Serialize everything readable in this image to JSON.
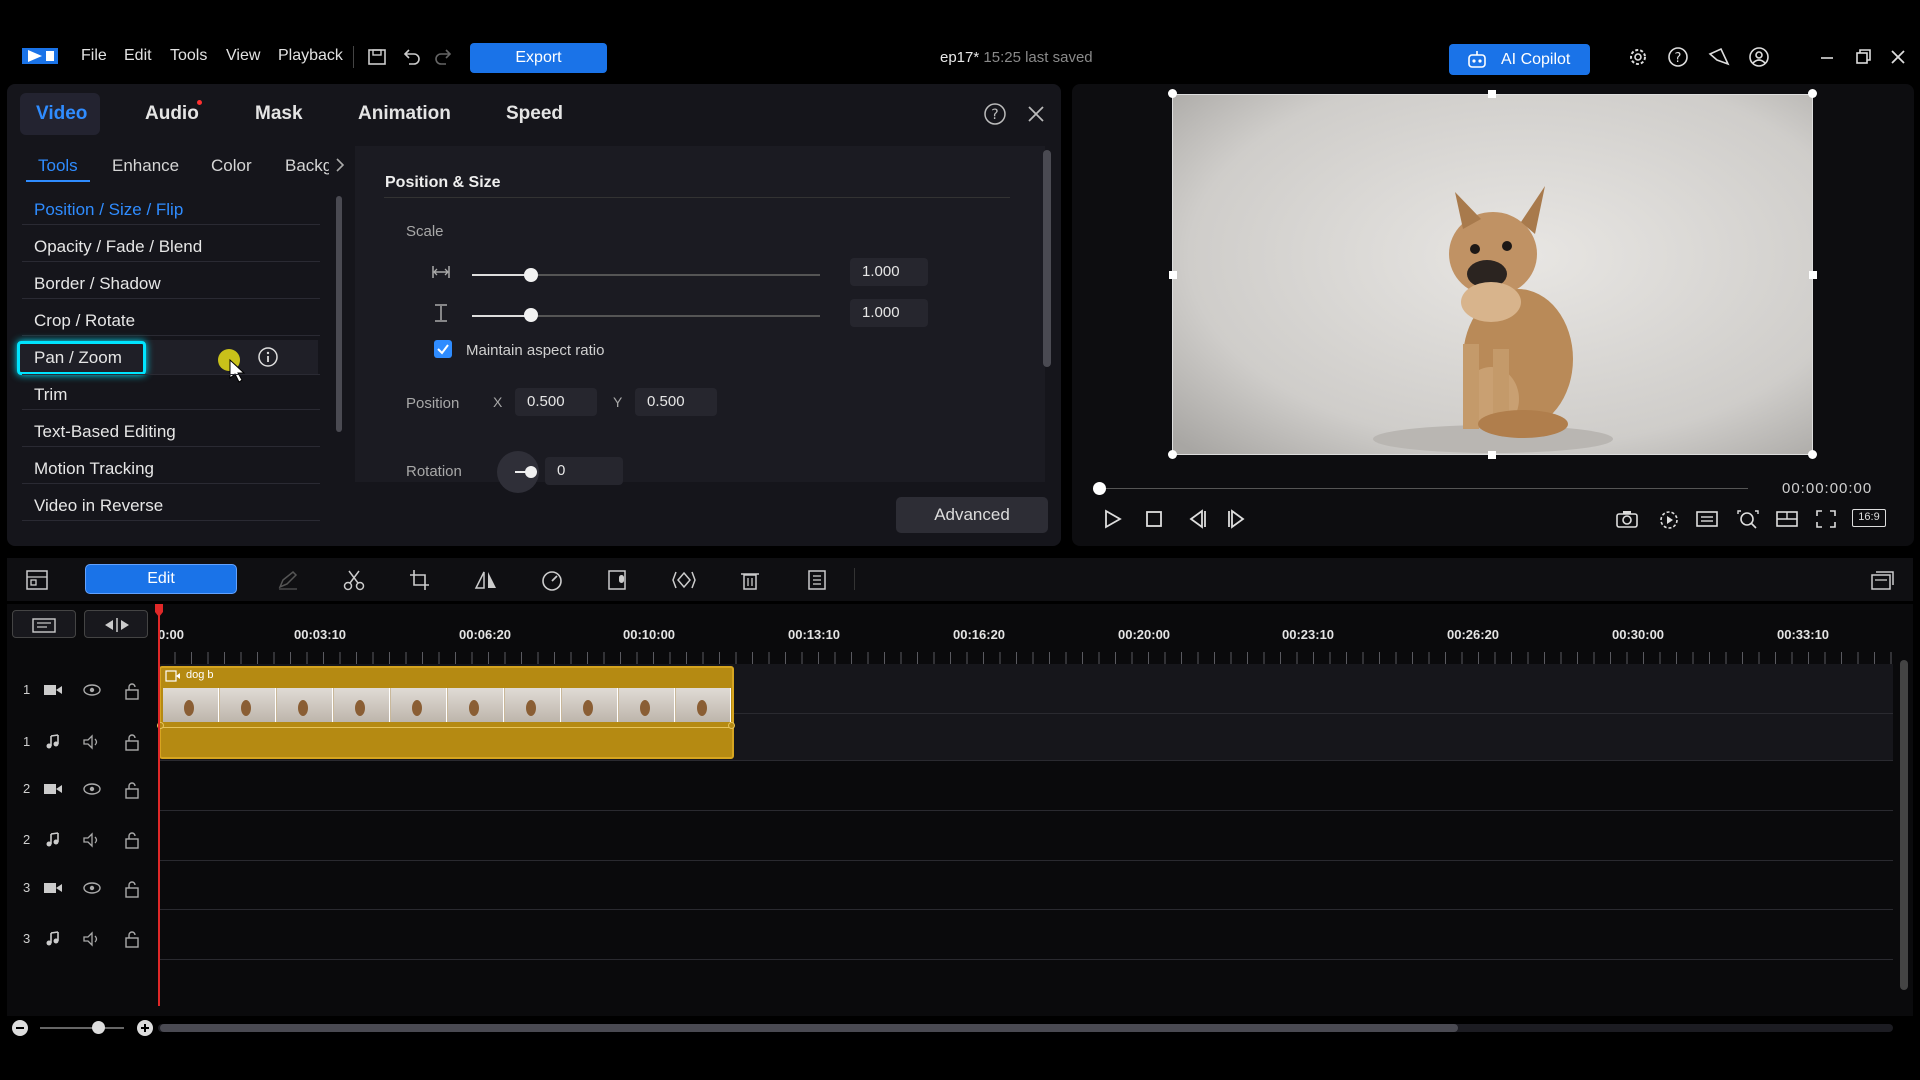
{
  "menu": {
    "file": "File",
    "edit": "Edit",
    "tools": "Tools",
    "view": "View",
    "playback": "Playback"
  },
  "export_label": "Export",
  "project": {
    "name": "ep17*",
    "saved": "15:25 last saved"
  },
  "copilot_label": "AI Copilot",
  "main_tabs": [
    "Video",
    "Audio",
    "Mask",
    "Animation",
    "Speed"
  ],
  "sub_tabs": [
    "Tools",
    "Enhance",
    "Color",
    "Backg"
  ],
  "tools": [
    "Position / Size / Flip",
    "Opacity / Fade / Blend",
    "Border / Shadow",
    "Crop / Rotate",
    "Pan / Zoom",
    "Trim",
    "Text-Based Editing",
    "Motion Tracking",
    "Video in Reverse"
  ],
  "props": {
    "section_title": "Position & Size",
    "scale_label": "Scale",
    "scale_w": "1.000",
    "scale_h": "1.000",
    "scale_w_fraction": 0.17,
    "scale_h_fraction": 0.17,
    "maintain_label": "Maintain aspect ratio",
    "position_label": "Position",
    "x_label": "X",
    "x_value": "0.500",
    "y_label": "Y",
    "y_value": "0.500",
    "rotation_label": "Rotation",
    "rotation_value": "0",
    "advanced_label": "Advanced"
  },
  "preview": {
    "timecode": "00:00:00:00",
    "aspect": "16:9"
  },
  "toolbar": {
    "edit_label": "Edit"
  },
  "ruler": [
    "0:00",
    "00:03:10",
    "00:06:20",
    "00:10:00",
    "00:13:10",
    "00:16:20",
    "00:20:00",
    "00:23:10",
    "00:26:20",
    "00:30:00",
    "00:33:10"
  ],
  "tracks": [
    "1",
    "1",
    "2",
    "2",
    "3",
    "3"
  ],
  "clip": {
    "name": "dog b"
  },
  "colors": {
    "accent": "#1a73e8",
    "clip": "#b58a12",
    "playhead": "#e02828",
    "highlight": "#00e5ff"
  }
}
